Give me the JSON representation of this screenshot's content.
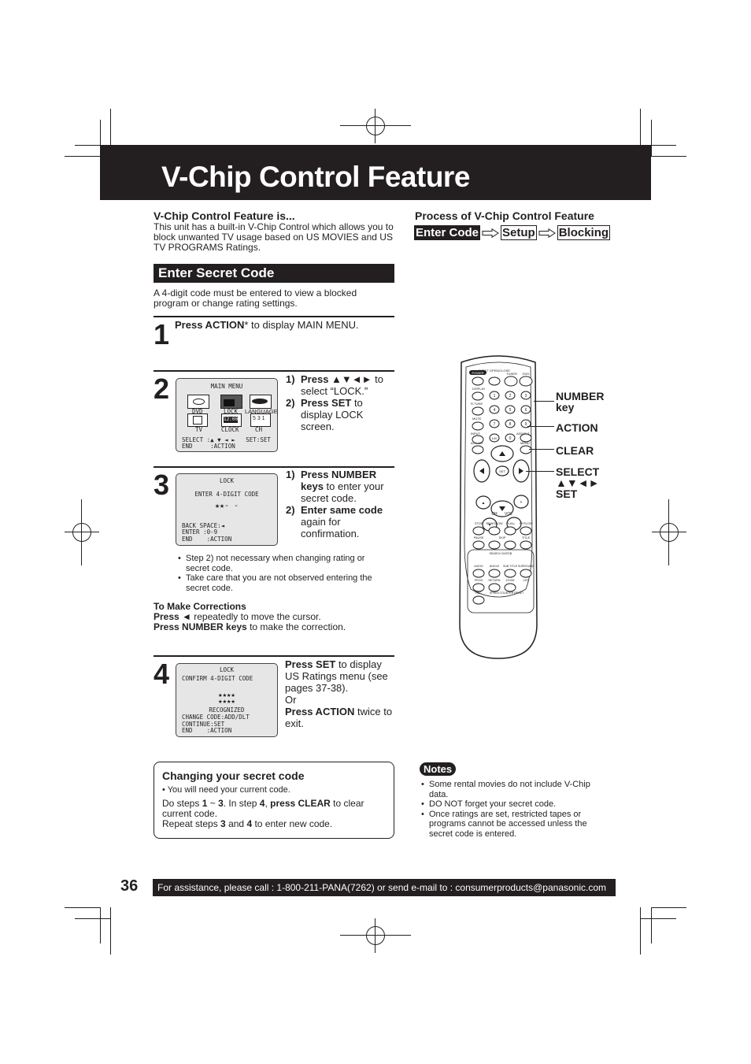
{
  "page": {
    "title": "V-Chip Control Feature",
    "page_number": "36",
    "footer": "For assistance, please call : 1-800-211-PANA(7262) or send e-mail to : consumerproducts@panasonic.com"
  },
  "intro": {
    "heading": "V-Chip Control Feature is...",
    "text": "This unit has a built-in V-Chip Control which allows you to block unwanted TV usage based on US MOVIES and US TV PROGRAMS Ratings."
  },
  "process": {
    "heading": "Process of V-Chip Control Feature",
    "steps": [
      "Enter Code",
      "Setup",
      "Blocking"
    ],
    "arrow_icon": "outline-right-arrow"
  },
  "secret_code": {
    "section_title": "Enter Secret Code",
    "description": "A 4-digit code must be entered to view a blocked program or change rating settings."
  },
  "steps": [
    {
      "number": "1",
      "bold": "Press ACTION",
      "rest": "* to display MAIN MENU."
    },
    {
      "number": "2",
      "osd": {
        "title": "MAIN MENU",
        "icons": [
          "DVD",
          "LOCK",
          "LANGUAGE",
          "TV",
          "CLOCK",
          "CH"
        ],
        "clock_display": "12:00",
        "ch_display": "5 3 1",
        "select_line": "SELECT :▲ ▼ ◄ ►   SET:SET",
        "end_line": "END     :ACTION"
      },
      "instructions": [
        {
          "num": "1)",
          "bold": "Press ▲▼◄►",
          "rest": " to select “LOCK.”"
        },
        {
          "num": "2)",
          "bold": "Press SET",
          "rest": " to display LOCK screen."
        }
      ]
    },
    {
      "number": "3",
      "osd": {
        "title": "LOCK",
        "line1": "ENTER 4-DIGIT CODE",
        "code": "★★- -",
        "line2": "BACK SPACE:◄",
        "line3": "ENTER :0-9",
        "line4": "END    :ACTION"
      },
      "instructions": [
        {
          "num": "1)",
          "bold": "Press NUMBER keys",
          "rest": " to enter your secret code."
        },
        {
          "num": "2)",
          "bold": "Enter same code",
          "rest": " again for confirmation."
        }
      ],
      "bullets": [
        "Step 2) not necessary when changing rating or secret code.",
        "Take care that you are not observed entering the secret code."
      ]
    },
    {
      "number": "4",
      "osd": {
        "title": "LOCK",
        "line1": "CONFIRM 4-DIGIT CODE",
        "code1": "★★★★",
        "code2": "★★★★",
        "line2": "RECOGNIZED",
        "line3": "CHANGE CODE:ADD/DLT",
        "line4": "CONTINUE:SET",
        "line5": "END    :ACTION"
      },
      "text": {
        "p1_bold": "Press SET",
        "p1_rest": " to display US Ratings menu (see pages 37-38).",
        "or": "Or",
        "p2_bold": "Press ACTION",
        "p2_rest": " twice to exit."
      }
    }
  ],
  "corrections": {
    "heading": "To Make Corrections",
    "line1_bold": "Press ◄",
    "line1_rest": " repeatedly to move the cursor.",
    "line2_bold": "Press NUMBER keys",
    "line2_rest": " to make the correction."
  },
  "changing_code": {
    "heading": "Changing your secret code",
    "bullet": "You will need your current code.",
    "t1": "Do steps ",
    "t1b": "1",
    "t2": " ~ ",
    "t2b": "3",
    "t3": ". In step ",
    "t3b": "4",
    "t4": ", ",
    "t4b": "press CLEAR",
    "t5": " to clear current code.",
    "r1": "Repeat steps ",
    "r1b": "3",
    "r2": " and ",
    "r2b": "4",
    "r3": " to enter new code."
  },
  "notes": {
    "label": "Notes",
    "items": [
      "Some rental movies do not include V-Chip data.",
      "DO NOT forget your secret code.",
      "Once ratings are set, restricted tapes or programs cannot be accessed unless the secret code is entered."
    ]
  },
  "remote": {
    "callouts": {
      "number": "NUMBER key",
      "number_line1": "NUMBER",
      "number_line2": "key",
      "action": "ACTION",
      "clear": "CLEAR",
      "select": "SELECT",
      "select_arrows": "▲▼◄►",
      "set": "SET"
    },
    "labels": {
      "power": "POWER",
      "eject": "EJECT OPEN/CLOSE",
      "tuner": "TUNER",
      "dvd": "DVD",
      "display": "DISPLAY",
      "rtune": "R-TUNE",
      "mute": "MUTE",
      "input": "INPUT",
      "action": "ACTION",
      "addslt": "ADD/DLT",
      "menu": "MENU",
      "set": "SET",
      "ch": "CH",
      "vol": "VOL",
      "stop": "STOP",
      "rew": "REW/SLOW",
      "play": "PLAY",
      "ff": "FF/SLOW",
      "pause": "PAUSE",
      "skip": "SKIP",
      "title": "TITLE",
      "search": "SEARCH  DATE/B",
      "audio": "AUDIO",
      "angle": "ANGLE",
      "subtitle": "SUB TITLE",
      "surround": "SURROUND",
      "prog": "PROG",
      "return": "RETURN",
      "zoom": "ZOOM",
      "vss": "VSS",
      "rec": "REC",
      "speed": "SPEED",
      "counter": "COUNTER RESET",
      "k100": "100",
      "keys": [
        "1",
        "2",
        "3",
        "4",
        "5",
        "6",
        "7",
        "8",
        "9",
        "0"
      ]
    }
  }
}
